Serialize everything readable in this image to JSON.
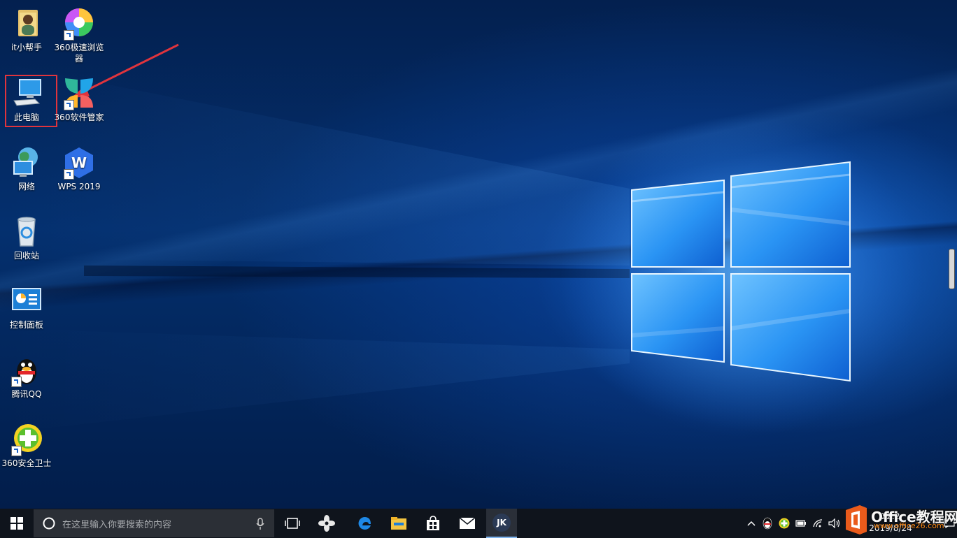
{
  "desktop": {
    "icons": [
      {
        "label": "it小帮手"
      },
      {
        "label": "360极速浏览器"
      },
      {
        "label": "此电脑"
      },
      {
        "label": "360软件管家"
      },
      {
        "label": "网络"
      },
      {
        "label": "WPS 2019"
      },
      {
        "label": "回收站"
      },
      {
        "label": "控制面板"
      },
      {
        "label": "腾讯QQ"
      },
      {
        "label": "360安全卫士"
      }
    ],
    "selected_icon": "此电脑",
    "annotation_color": "#e0343d"
  },
  "taskbar": {
    "search_placeholder": "在这里输入你要搜索的内容",
    "pinned": [
      {
        "icon": "task-view-icon"
      },
      {
        "icon": "fan-app-icon"
      },
      {
        "icon": "edge-icon"
      },
      {
        "icon": "file-explorer-icon"
      },
      {
        "icon": "store-icon"
      },
      {
        "icon": "mail-icon"
      },
      {
        "icon": "jk-app-icon",
        "label": "JK"
      }
    ],
    "clock": {
      "time": "22:2",
      "date": "2019/8/24"
    },
    "accent": "#2c7cd8"
  },
  "watermark": {
    "brand": "Office教程网",
    "site": "www.office26.com"
  }
}
